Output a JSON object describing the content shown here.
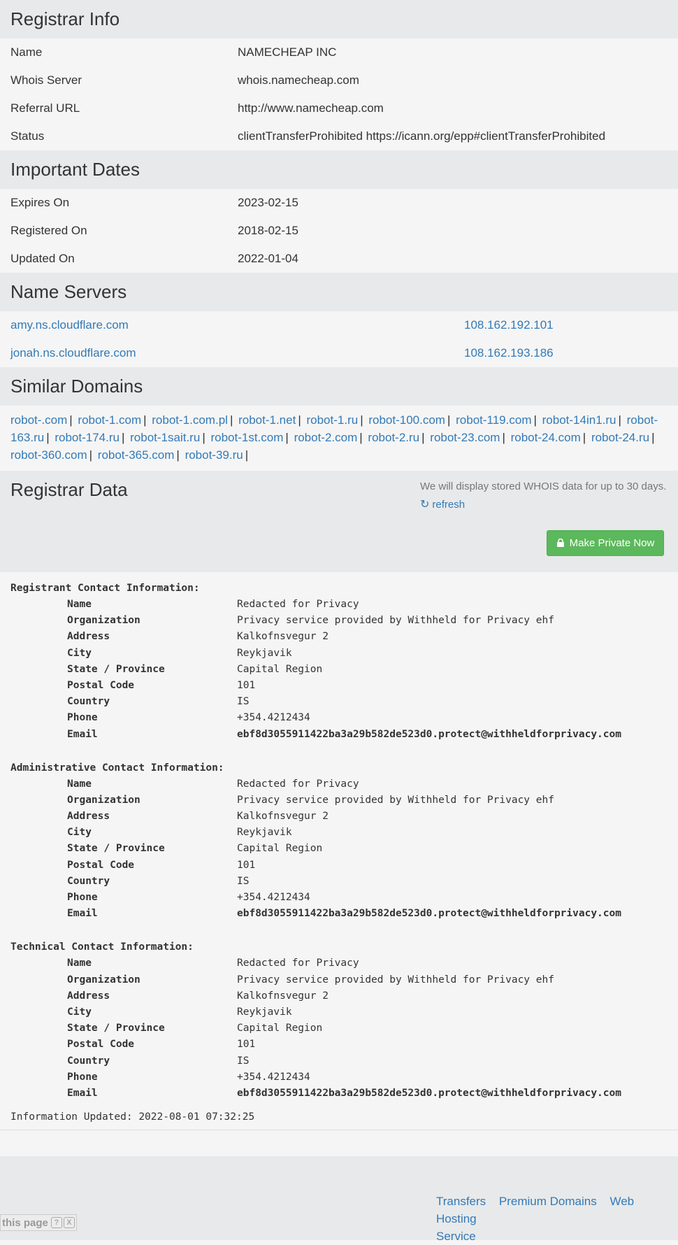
{
  "registrar_info": {
    "title": "Registrar Info",
    "rows": [
      {
        "key": "Name",
        "value": "NAMECHEAP INC"
      },
      {
        "key": "Whois Server",
        "value": "whois.namecheap.com"
      },
      {
        "key": "Referral URL",
        "value": "http://www.namecheap.com"
      },
      {
        "key": "Status",
        "value": "clientTransferProhibited https://icann.org/epp#clientTransferProhibited"
      }
    ]
  },
  "important_dates": {
    "title": "Important Dates",
    "rows": [
      {
        "key": "Expires On",
        "value": "2023-02-15"
      },
      {
        "key": "Registered On",
        "value": "2018-02-15"
      },
      {
        "key": "Updated On",
        "value": "2022-01-04"
      }
    ]
  },
  "name_servers": {
    "title": "Name Servers",
    "rows": [
      {
        "host": "amy.ns.cloudflare.com",
        "ip": "108.162.192.101"
      },
      {
        "host": "jonah.ns.cloudflare.com",
        "ip": "108.162.193.186"
      }
    ]
  },
  "similar_domains": {
    "title": "Similar Domains",
    "separator": "|",
    "items": [
      "robot-.com",
      "robot-1.com",
      "robot-1.com.pl",
      "robot-1.net",
      "robot-1.ru",
      "robot-100.com",
      "robot-119.com",
      "robot-14in1.ru",
      "robot-163.ru",
      "robot-174.ru",
      "robot-1sait.ru",
      "robot-1st.com",
      "robot-2.com",
      "robot-2.ru",
      "robot-23.com",
      "robot-24.com",
      "robot-24.ru",
      "robot-360.com",
      "robot-365.com",
      "robot-39.ru"
    ]
  },
  "registrar_data": {
    "title": "Registrar Data",
    "note": "We will display stored WHOIS data for up to 30 days.",
    "refresh_label": "refresh",
    "private_button": "Make Private Now"
  },
  "contacts": [
    {
      "title": "Registrant Contact Information:",
      "rows": [
        {
          "key": "Name",
          "value": "Redacted for Privacy"
        },
        {
          "key": "Organization",
          "value": "Privacy service provided by Withheld for Privacy ehf"
        },
        {
          "key": "Address",
          "value": "Kalkofnsvegur 2"
        },
        {
          "key": "City",
          "value": "Reykjavik"
        },
        {
          "key": "State / Province",
          "value": "Capital Region"
        },
        {
          "key": "Postal Code",
          "value": "101"
        },
        {
          "key": "Country",
          "value": "IS"
        },
        {
          "key": "Phone",
          "value": "+354.4212434"
        },
        {
          "key": "Email",
          "value": "ebf8d3055911422ba3a29b582de523d0.protect@withheldforprivacy.com"
        }
      ]
    },
    {
      "title": "Administrative Contact Information:",
      "rows": [
        {
          "key": "Name",
          "value": "Redacted for Privacy"
        },
        {
          "key": "Organization",
          "value": "Privacy service provided by Withheld for Privacy ehf"
        },
        {
          "key": "Address",
          "value": "Kalkofnsvegur 2"
        },
        {
          "key": "City",
          "value": "Reykjavik"
        },
        {
          "key": "State / Province",
          "value": "Capital Region"
        },
        {
          "key": "Postal Code",
          "value": "101"
        },
        {
          "key": "Country",
          "value": "IS"
        },
        {
          "key": "Phone",
          "value": "+354.4212434"
        },
        {
          "key": "Email",
          "value": "ebf8d3055911422ba3a29b582de523d0.protect@withheldforprivacy.com"
        }
      ]
    },
    {
      "title": "Technical Contact Information:",
      "rows": [
        {
          "key": "Name",
          "value": "Redacted for Privacy"
        },
        {
          "key": "Organization",
          "value": "Privacy service provided by Withheld for Privacy ehf"
        },
        {
          "key": "Address",
          "value": "Kalkofnsvegur 2"
        },
        {
          "key": "City",
          "value": "Reykjavik"
        },
        {
          "key": "State / Province",
          "value": "Capital Region"
        },
        {
          "key": "Postal Code",
          "value": "101"
        },
        {
          "key": "Country",
          "value": "IS"
        },
        {
          "key": "Phone",
          "value": "+354.4212434"
        },
        {
          "key": "Email",
          "value": "ebf8d3055911422ba3a29b582de523d0.protect@withheldforprivacy.com"
        }
      ]
    }
  ],
  "information_updated": "Information Updated: 2022-08-01 07:32:25",
  "footer": {
    "links": [
      "Transfers",
      "Premium Domains",
      "Web Hosting"
    ],
    "second_line": "Service"
  },
  "feedback_widget": {
    "label": "this page",
    "help_icon": "?",
    "close_icon": "X"
  }
}
